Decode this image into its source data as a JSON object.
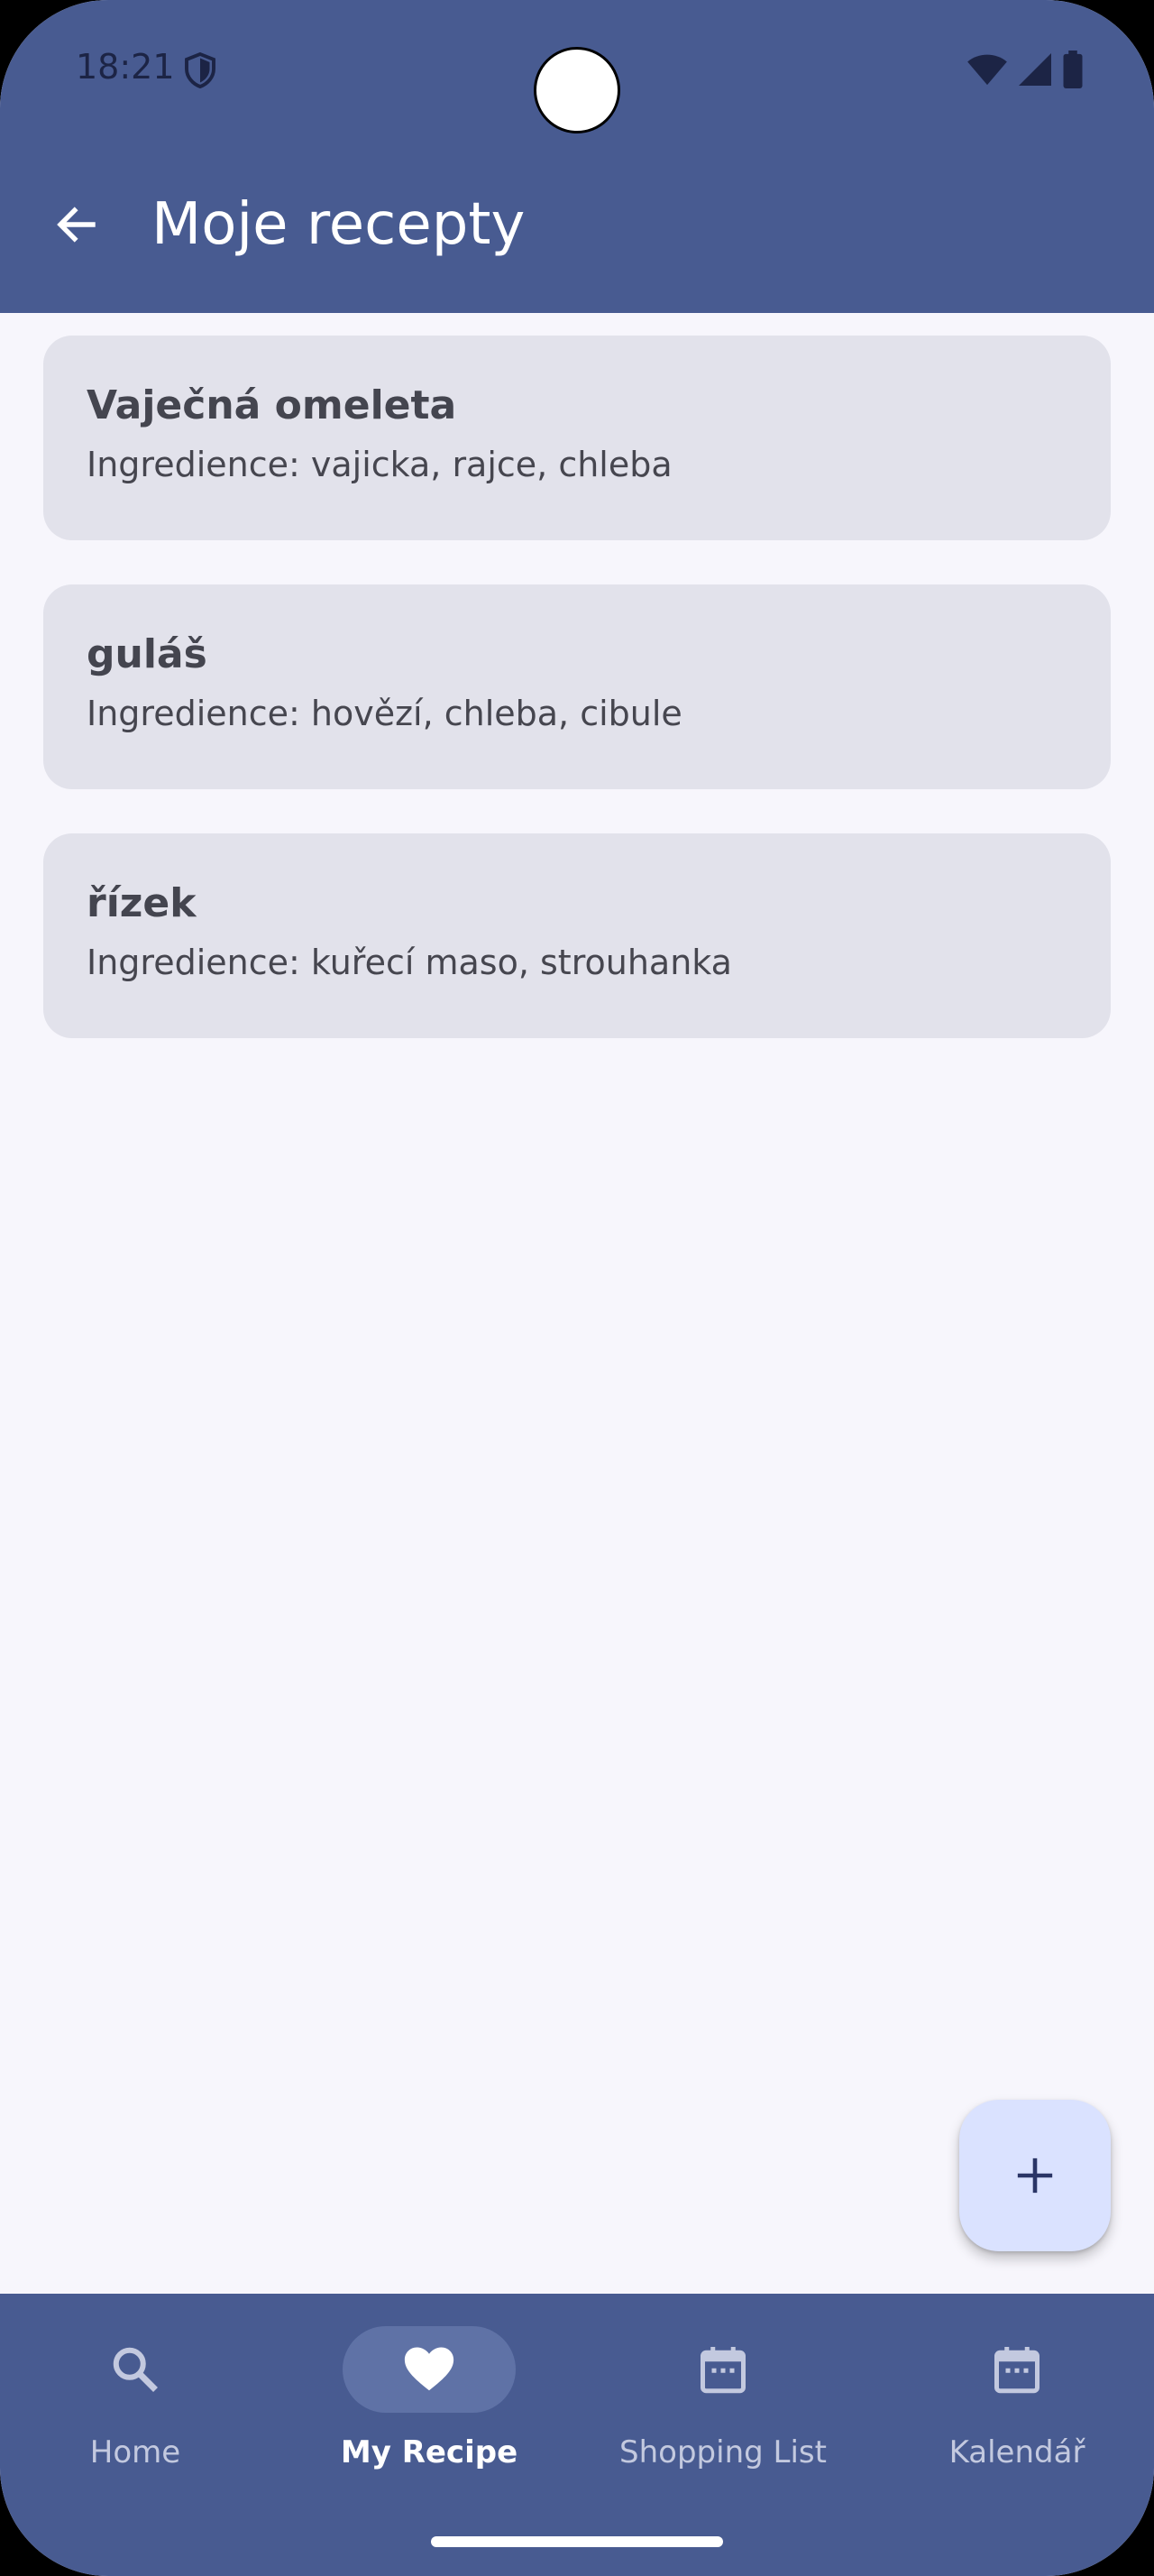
{
  "status_bar": {
    "time": "18:21",
    "icons": [
      "shield-icon",
      "wifi-icon",
      "signal-icon",
      "battery-icon"
    ]
  },
  "app_bar": {
    "back_icon": "arrow-back-icon",
    "title": "Moje recepty"
  },
  "recipes": [
    {
      "title": "Vaječná omeleta",
      "ingredients": "Ingredience: vajicka, rajce, chleba"
    },
    {
      "title": "guláš",
      "ingredients": "Ingredience: hovězí, chleba, cibule"
    },
    {
      "title": "řízek",
      "ingredients": "Ingredience: kuřecí maso, strouhanka"
    }
  ],
  "fab": {
    "icon": "plus-icon"
  },
  "bottom_nav": {
    "items": [
      {
        "label": "Home",
        "icon": "search-icon",
        "active": false
      },
      {
        "label": "My Recipe",
        "icon": "heart-icon",
        "active": true
      },
      {
        "label": "Shopping List",
        "icon": "calendar-icon",
        "active": false
      },
      {
        "label": "Kalendář",
        "icon": "calendar-icon",
        "active": false
      }
    ]
  },
  "colors": {
    "primary": "#485b91",
    "background": "#f7f6fc",
    "card": "#e2e2eb",
    "fab": "#dae2ff"
  }
}
